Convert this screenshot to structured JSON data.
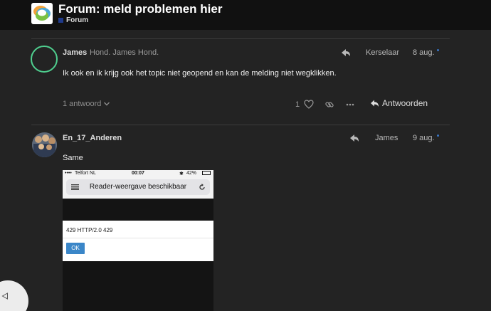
{
  "header": {
    "title": "Forum: meld problemen hier",
    "category": "Forum",
    "category_color": "#1f3a8a"
  },
  "posts": [
    {
      "username": "James",
      "full_name": "Hond. James Hond.",
      "reply_to": "Kerselaar",
      "date": "8 aug.",
      "text": "Ik ook en ik krijg ook het topic niet geopend en kan de melding niet wegklikken.",
      "replies_label": "1 antwoord",
      "like_count": "1",
      "reply_label": "Antwoorden",
      "avatar_ring_color": "#4fcf8f"
    },
    {
      "username": "En_17_Anderen",
      "reply_to": "James",
      "date": "9 aug.",
      "text": "Same"
    }
  ],
  "screenshot": {
    "carrier": "Telfort NL",
    "time": "00:07",
    "battery": "42%",
    "url_text": "Reader-weergave beschikbaar",
    "error_message": "429 HTTP/2.0 429",
    "ok_label": "OK"
  },
  "icons": [
    "forum-logo-icon",
    "reply-arrow-icon",
    "chevron-down-icon",
    "heart-icon",
    "link-icon",
    "more-icon",
    "reply-icon",
    "play-icon"
  ],
  "colors": {
    "background": "#232323",
    "header": "#111111",
    "accent_dot": "#3a77c8",
    "ok_button": "#3a86c8"
  }
}
